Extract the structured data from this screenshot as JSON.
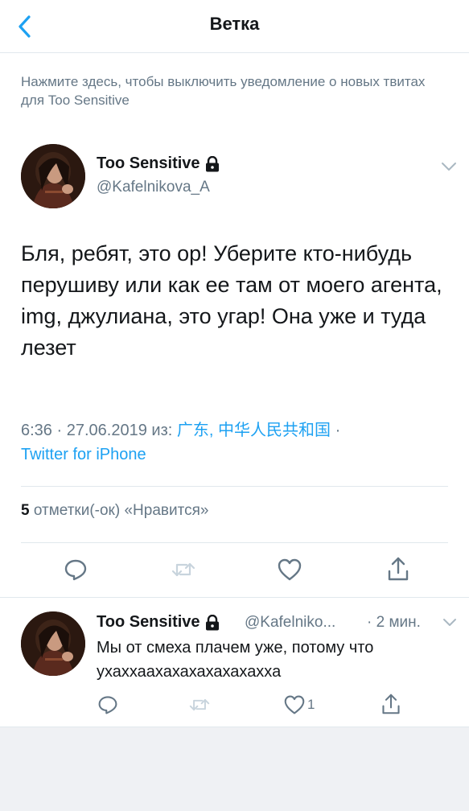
{
  "header": {
    "title": "Ветка"
  },
  "notice": {
    "text": "Нажмите здесь, чтобы выключить уведомление о новых твитах для Too Sensitive"
  },
  "tweet": {
    "author_name": "Too Sensitive",
    "author_handle": "@Kafelnikova_A",
    "text": "Бля, ребят, это ор! Уберите кто-нибудь перушиву или как ее там от моего агента, img, джулиана, это угар! Она уже и туда лезет",
    "time": "6:36",
    "date": "27.06.2019",
    "from_label": "из:",
    "location": "广东, 中华人民共和国",
    "separator": "·",
    "client": "Twitter for iPhone",
    "likes_count": "5",
    "likes_label": "отметки(-ок) «Нравится»"
  },
  "reply": {
    "author_name": "Too Sensitive",
    "author_handle": "@Kafelniko...",
    "time": "· 2 мин.",
    "text": "Мы от смеха плачем уже, потому что ухаххаахахахахахахахха",
    "like_count": "1"
  },
  "icons": {
    "back": "chevron-left-icon",
    "lock": "lock-icon",
    "more": "chevron-down-icon",
    "reply": "reply-icon",
    "retweet": "retweet-icon",
    "like": "heart-icon",
    "share": "share-icon"
  },
  "colors": {
    "accent": "#1da1f2",
    "text": "#14171a",
    "secondary": "#657786",
    "divider": "#e1e8ed",
    "retweet_disabled": "#c8d4dd"
  }
}
